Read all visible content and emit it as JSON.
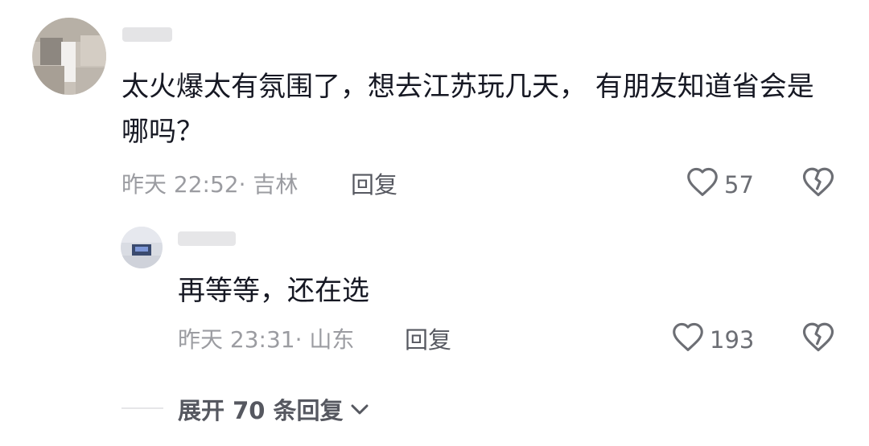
{
  "comment": {
    "text": "太火爆太有氛围了，想去江苏玩几天， 有朋友知道省会是哪吗？",
    "text_line1": "太火爆太有氛围了，想去江苏玩几天， 有朋友知道省会是哪吗？",
    "meta": "昨天 22:52· 吉林",
    "reply_label": "回复",
    "likes": "57"
  },
  "reply": {
    "text": "再等等，还在选",
    "meta": "昨天 23:31· 山东",
    "reply_label": "回复",
    "likes": "193"
  },
  "expand": {
    "label": "展开 70 条回复"
  },
  "icons": {
    "like": "heart-outline-icon",
    "dislike": "broken-heart-icon",
    "expand": "chevron-down-icon"
  }
}
